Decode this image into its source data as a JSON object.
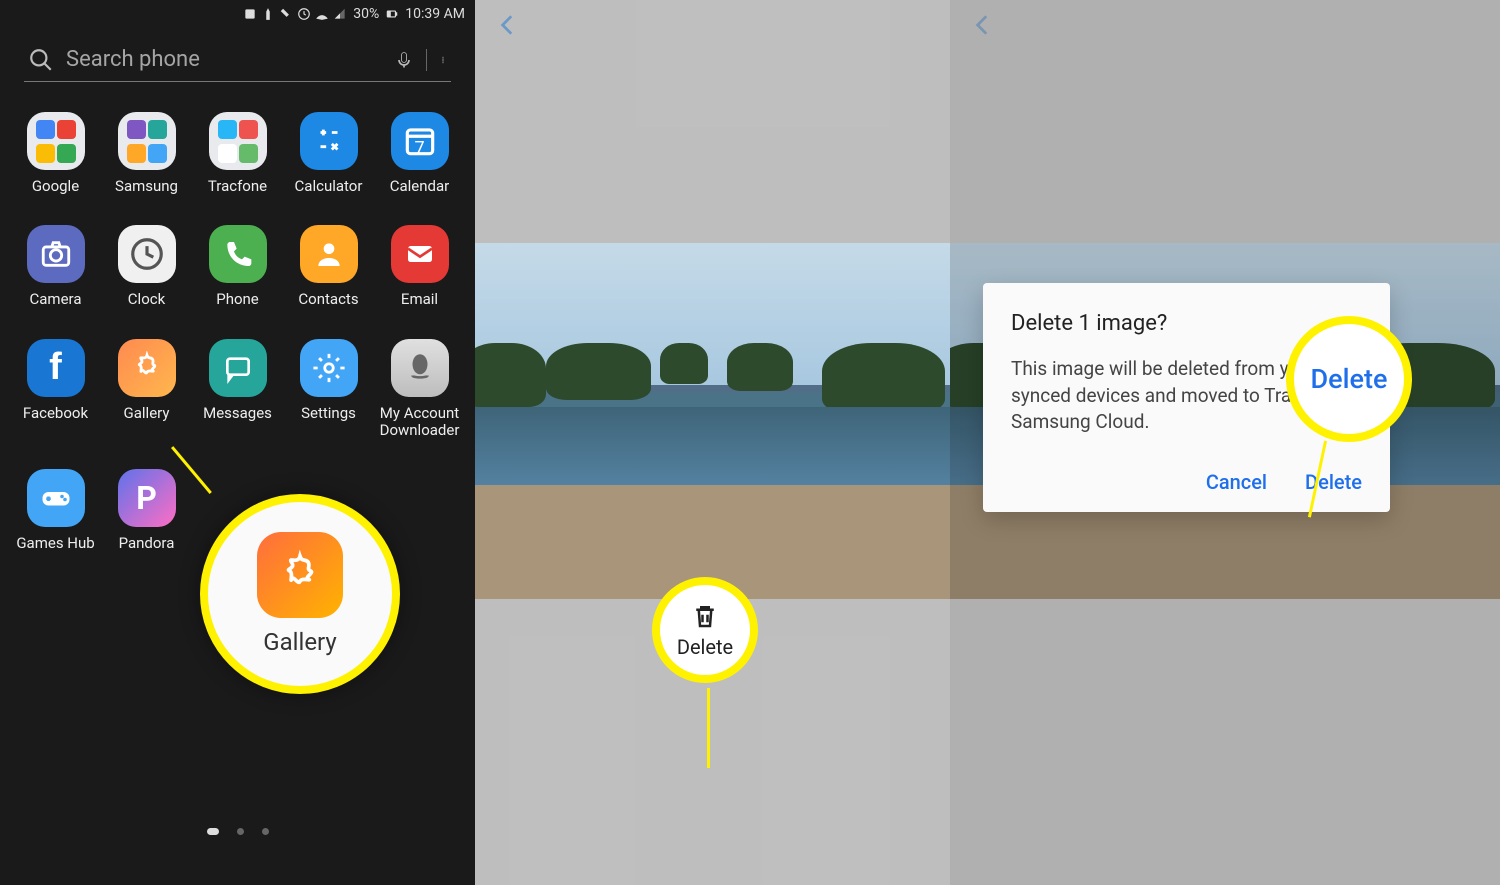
{
  "status": {
    "battery": "30%",
    "time": "10:39 AM"
  },
  "search": {
    "placeholder": "Search phone"
  },
  "apps": {
    "google": "Google",
    "samsung": "Samsung",
    "tracfone": "Tracfone",
    "calculator": "Calculator",
    "calendar": "Calendar",
    "camera": "Camera",
    "clock": "Clock",
    "phone": "Phone",
    "contacts": "Contacts",
    "email": "Email",
    "facebook": "Facebook",
    "gallery": "Gallery",
    "messages": "Messages",
    "settings": "Settings",
    "mad": "My Account Downloader",
    "gameshub": "Games Hub",
    "pandora": "Pandora"
  },
  "callout_gallery": "Gallery",
  "callout_delete": "Delete",
  "delete_button": "Delete",
  "dialog": {
    "title": "Delete 1 image?",
    "body": "This image will be deleted from your synced devices and moved to Trash in Samsung Cloud.",
    "cancel": "Cancel",
    "delete": "Delete"
  },
  "callout_dialog_delete": "Delete",
  "calendar_day": "7"
}
